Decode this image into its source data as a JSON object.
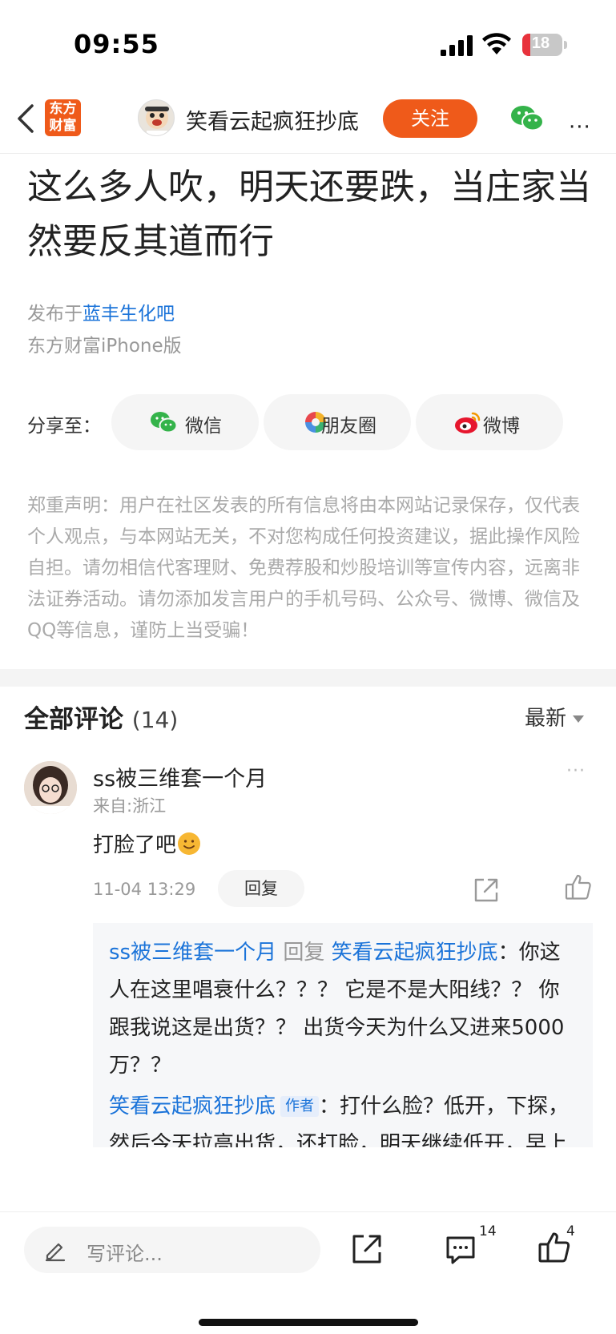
{
  "status_bar": {
    "time": "09:55",
    "battery": "18"
  },
  "nav": {
    "logo_line1": "东方",
    "logo_line2": "财富",
    "author": "笑看云起疯狂抄底",
    "follow_label": "关注",
    "more": "···"
  },
  "post": {
    "title": "这么多人吹，明天还要跌，当庄家当然要反其道而行",
    "published_prefix": "发布于",
    "bar_name": "蓝丰生化吧",
    "client": "东方财富iPhone版"
  },
  "share": {
    "label": "分享至：",
    "wechat": "微信",
    "moments": "朋友圈",
    "weibo": "微博"
  },
  "disclaimer": "郑重声明：用户在社区发表的所有信息将由本网站记录保存，仅代表个人观点，与本网站无关，不对您构成任何投资建议，据此操作风险自担。请勿相信代客理财、免费荐股和炒股培训等宣传内容，远离非法证券活动。请勿添加发言用户的手机号码、公众号、微博、微信及QQ等信息，谨防上当受骗！",
  "comments": {
    "title": "全部评论",
    "count": "(14)",
    "sort": "最新",
    "items": [
      {
        "user": "ss被三维套一个月",
        "from": "来自:浙江",
        "text": "打脸了吧",
        "time": "11-04 13:29",
        "reply_label": "回复",
        "more": "···",
        "replies": [
          {
            "user": "ss被三维套一个月",
            "verb": "回复",
            "target": "笑看云起疯狂抄底",
            "text": "你这人在这里唱衰什么？？？ 它是不是大阳线？？ 你跟我说这是出货？？ 出货今天为什么又进来5000万？？"
          },
          {
            "user": "笑看云起疯狂抄底",
            "tag": "作者",
            "text": "打什么脸？低开，下探，然后今天拉高出货，还打脸，明天继续低开，早上怎么没见你出来叫呢？"
          }
        ]
      }
    ]
  },
  "bottom_bar": {
    "placeholder": "写评论...",
    "comment_count": "14",
    "like_count": "4"
  },
  "colors": {
    "accent": "#ef5a1a",
    "link": "#1a73d9"
  }
}
